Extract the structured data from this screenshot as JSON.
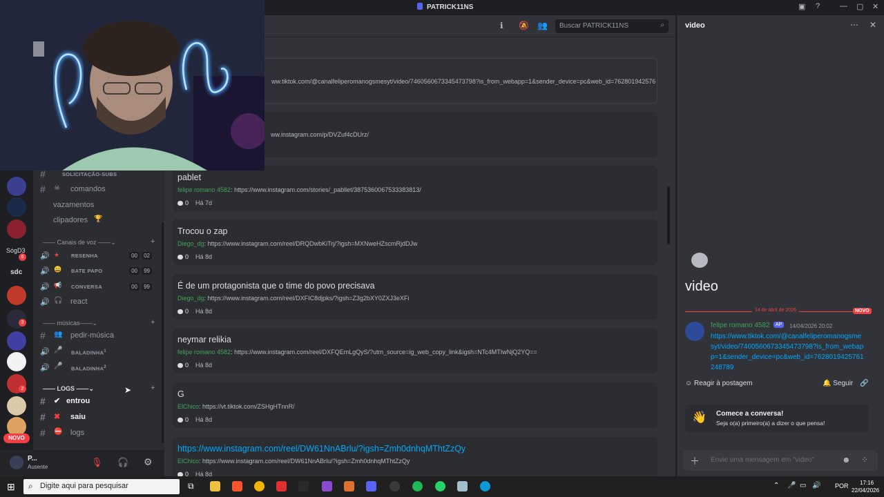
{
  "window": {
    "title": "PATRICK11NS"
  },
  "header": {
    "search_placeholder": "Buscar PATRICK11NS"
  },
  "channels": {
    "items": [
      {
        "label": "SOLICITAÇÃO-SUBS"
      },
      {
        "label": "comandos"
      },
      {
        "label": "vazamentos"
      },
      {
        "label": "clipadores"
      }
    ],
    "voice_category": "Canais de voz",
    "voice": [
      {
        "label": "RESENHA",
        "count_a": "00",
        "count_b": "02"
      },
      {
        "label": "BATE PAPO",
        "count_a": "00",
        "count_b": "99"
      },
      {
        "label": "CONVERSA",
        "count_a": "00",
        "count_b": "99"
      },
      {
        "label": "react"
      }
    ],
    "music_category": "músicas",
    "music": [
      {
        "label": "pedir-música"
      },
      {
        "label": "BALADINHA",
        "sup": "1"
      },
      {
        "label": "BALADINHA",
        "sup": "2"
      }
    ],
    "logs_category": "LOGS",
    "logs": [
      {
        "label": "entrou"
      },
      {
        "label": "saiu"
      },
      {
        "label": "logs"
      }
    ]
  },
  "guilds": {
    "badge_label": "NOVO",
    "sog_label": "SógD3",
    "sdc_label": "sdc",
    "badges": [
      "6",
      "3",
      "2"
    ]
  },
  "user": {
    "name": "P...",
    "status": "Ausente"
  },
  "posts": [
    {
      "title": "",
      "line": "ww.tiktok.com/@canalfeliperomanogsmesyt/video/7460560673345473798?is_from_webapp=1&sender_device=pc&web_id=762801942576..."
    },
    {
      "title": "",
      "line": "ww.instagram.com/p/DVZuf4cDUrz/"
    },
    {
      "title": "pablet",
      "author": "felipe romano 4582",
      "line": "https://www.instagram.com/stories/_pabllet/3875360067533383813/",
      "replies": "0",
      "age": "Há 7d"
    },
    {
      "title": "Trocou o zap",
      "author": "Diego_dg",
      "line": "https://www.instagram.com/reel/DRQDwbKiTrj/?igsh=MXNweHZscmRjdDJw",
      "replies": "0",
      "age": "Há 8d"
    },
    {
      "title": "É de um protagonista que o time do povo precisava",
      "author": "Diego_dg",
      "line": "https://www.instagram.com/reel/DXFIC8djpks/?igsh=Z3g2bXY0ZXJ3eXFi",
      "replies": "0",
      "age": "Há 8d"
    },
    {
      "title": "neymar relikia",
      "author": "felipe romano 4582",
      "line": "https://www.instagram.com/reel/DXFQEmLgQyS/?utm_source=ig_web_copy_link&igsh=NTc4MTIwNjQ2YQ==",
      "replies": "0",
      "age": "Há 8d"
    },
    {
      "title": "G",
      "author": "ElChico",
      "line": "https://vt.tiktok.com/ZSHgHTnnR/",
      "replies": "0",
      "age": "Há 8d"
    },
    {
      "title": "https://www.instagram.com/reel/DW61NnABrlu/?igsh=Zmh0dnhqMThtZzQy",
      "author": "ElChico",
      "line": "https://www.instagram.com/reel/DW61NnABrlu/?igsh=Zmh0dnhqMThtZzQy",
      "replies": "0",
      "age": "Há 8d"
    }
  ],
  "side": {
    "header_title": "video",
    "thread_title": "video",
    "date_divider": "14 de abril de 2026",
    "new_badge": "NOVO",
    "author": "felipe romano 4582",
    "author_tag": "AP",
    "timestamp": "14/04/2026 20:02",
    "message_link": "https://www.tiktok.com/@canalfeliperomanogsmesyt/video/7460560673345473798?is_from_webapp=1&sender_device=pc&web_id=7628019425761248789",
    "react_label": "Reagir à postagem",
    "follow_label": "Seguir",
    "cta_title": "Comece a conversa!",
    "cta_sub": "Seja o(a) primeiro(a) a dizer o que pensa!",
    "composer_placeholder": "Envie uma mensagem em \"video\""
  },
  "taskbar": {
    "search_placeholder": "Digite aqui para pesquisar",
    "lang": "POR",
    "time": "17:16",
    "date": "22/04/2026"
  }
}
